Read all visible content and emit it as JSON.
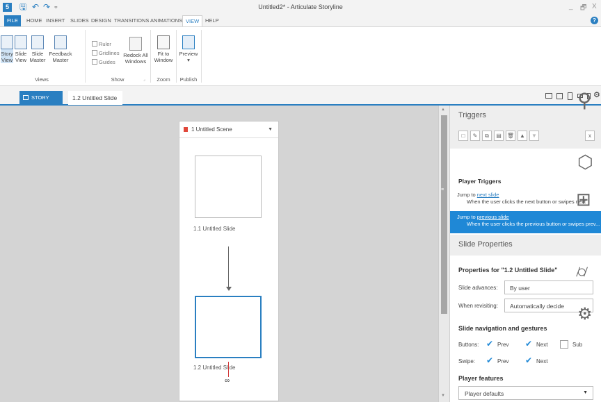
{
  "window": {
    "title": "Untitled2* - Articulate Storyline",
    "app_icon": "5",
    "minimize": "_",
    "restore": "🗗",
    "close": "X"
  },
  "ribbon": {
    "tabs": [
      "FILE",
      "HOME",
      "INSERT",
      "SLIDES",
      "DESIGN",
      "TRANSITIONS",
      "ANIMATIONS",
      "VIEW",
      "HELP"
    ],
    "active_tab": "VIEW",
    "help": "?",
    "buttons": {
      "story_view": [
        "Story",
        "View"
      ],
      "slide_view": [
        "Slide",
        "View"
      ],
      "slide_master": [
        "Slide",
        "Master"
      ],
      "feedback_master": [
        "Feedback",
        "Master"
      ],
      "redock": [
        "Redock All",
        "Windows"
      ],
      "fit_window": [
        "Fit to",
        "Window"
      ],
      "preview": [
        "Preview",
        "▾"
      ]
    },
    "checks": {
      "ruler": "Ruler",
      "gridlines": "Gridlines",
      "guides": "Guides"
    },
    "groups": {
      "views": "Views",
      "show": "Show",
      "zoom": "Zoom",
      "publish": "Publish"
    }
  },
  "viewbar": {
    "story_view": "STORY VIEW",
    "slide_tab": "1.2 Untitled Slide"
  },
  "canvas": {
    "scene_title": "1 Untitled Scene",
    "slides": [
      "1.1 Untitled Slide",
      "1.2 Untitled Slide"
    ]
  },
  "triggers": {
    "heading": "Triggers",
    "player_triggers": "Player Triggers",
    "items": [
      {
        "prefix": "Jump to ",
        "link": "next slide",
        "desc": "When the user clicks the next button or swipes next"
      },
      {
        "prefix": "Jump to ",
        "link": "previous slide",
        "desc": "When the user clicks the previous button or swipes prev..."
      }
    ]
  },
  "slide_properties": {
    "heading": "Slide Properties",
    "properties_for": "Properties for \"1.2 Untitled Slide\"",
    "advances_label": "Slide advances:",
    "advances_value": "By user",
    "revisiting_label": "When revisiting:",
    "revisiting_value": "Automatically decide",
    "nav_title": "Slide navigation and gestures",
    "buttons_label": "Buttons:",
    "swipe_label": "Swipe:",
    "prev": "Prev",
    "next": "Next",
    "submit_partial": "Sub",
    "player_features": "Player features",
    "player_defaults": "Player defaults"
  }
}
